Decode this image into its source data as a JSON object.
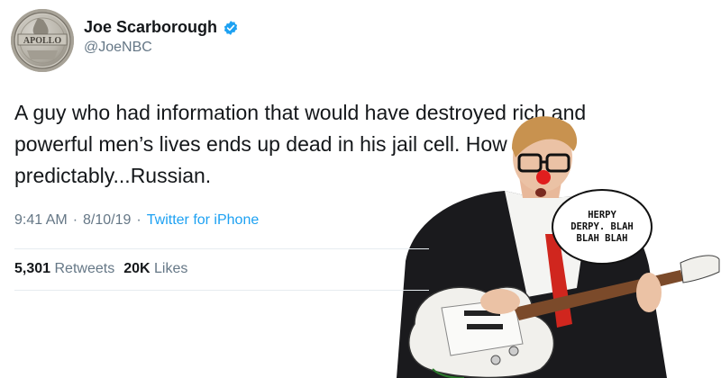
{
  "profile": {
    "name": "Joe Scarborough",
    "handle": "@JoeNBC",
    "avatar_icon": "apollo-coin-avatar",
    "avatar_text": "APOLLO"
  },
  "tweet": {
    "text_lines": [
      "A guy who had information that would have destroyed rich and",
      "powerful men’s lives ends up dead in his jail cell. How",
      "predictably...Russian."
    ],
    "time": "9:41 AM",
    "sep1": "·",
    "date": "8/10/19",
    "sep2": "·",
    "source": "Twitter for iPhone"
  },
  "stats": {
    "retweets_count": "5,301",
    "retweets_label": "Retweets",
    "likes_count": "20K",
    "likes_label": "Likes"
  },
  "image": {
    "bubble_lines": [
      "HERPY",
      "DERPY. BLAH",
      "BLAH BLAH"
    ]
  },
  "colors": {
    "link": "#1da1f2",
    "secondary_text": "#657786",
    "primary_text": "#14171a",
    "verified": "#1da1f2"
  }
}
